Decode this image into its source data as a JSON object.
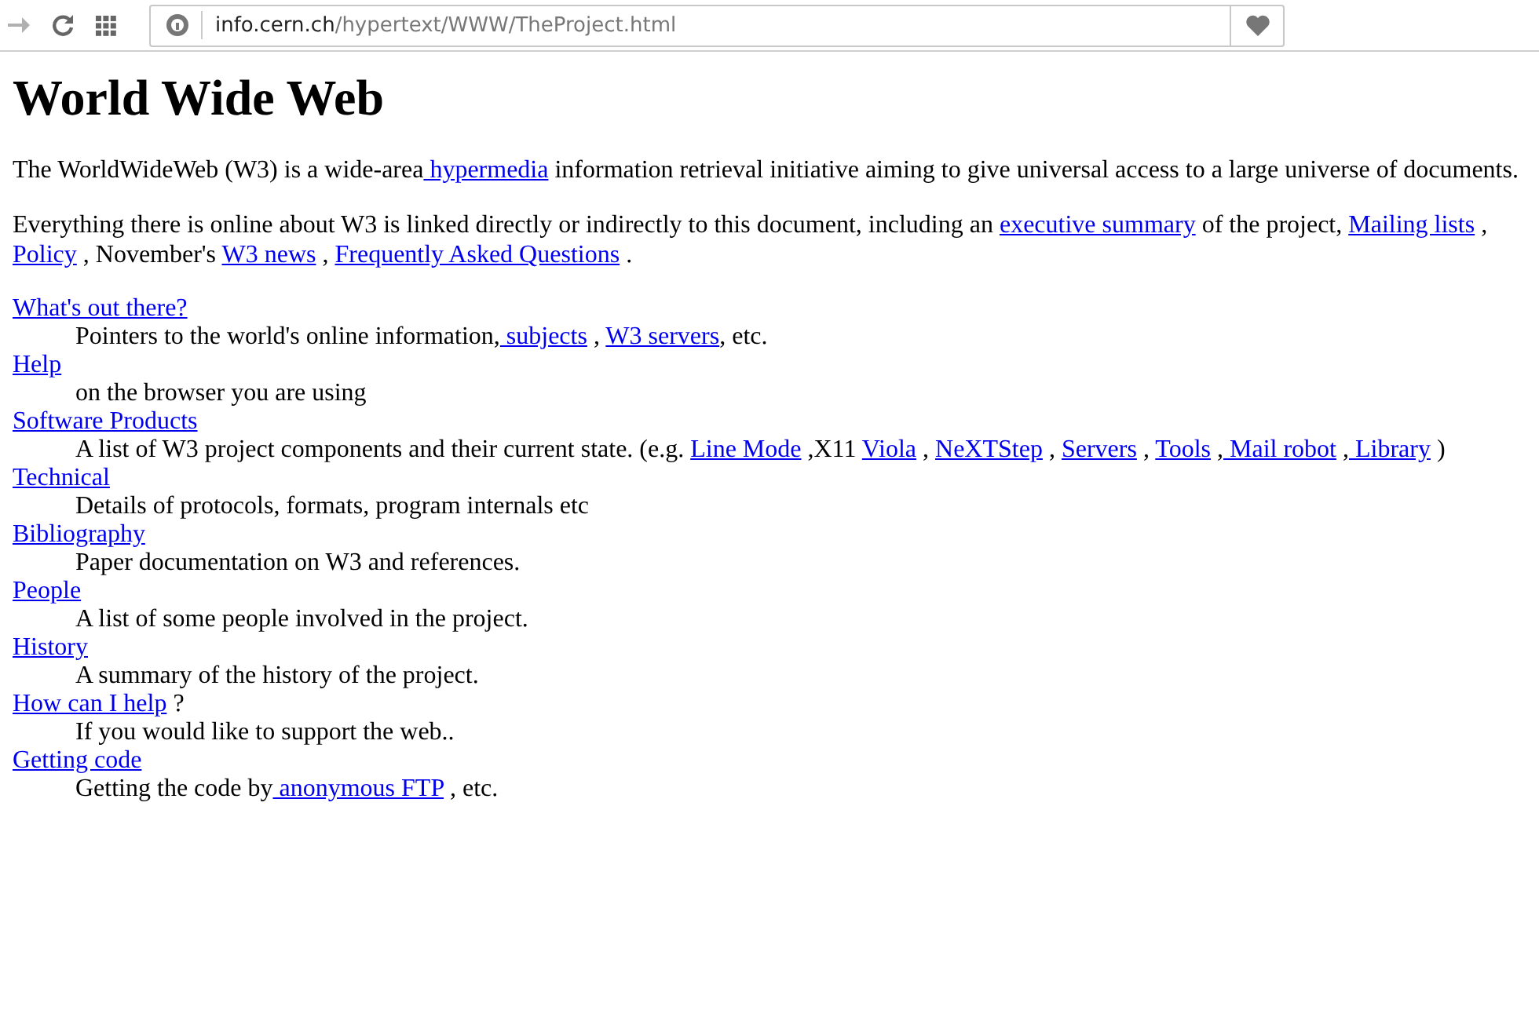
{
  "toolbar": {
    "url_host": "info.cern.ch",
    "url_path": "/hypertext/WWW/TheProject.html"
  },
  "heading": "World Wide Web",
  "paragraphs": [
    [
      {
        "kind": "text",
        "text": "The WorldWideWeb (W3) is a wide-area"
      },
      {
        "kind": "link",
        "text": " hypermedia"
      },
      {
        "kind": "text",
        "text": " information retrieval initiative aiming to give universal access to a large universe of documents."
      }
    ],
    [
      {
        "kind": "text",
        "text": "Everything there is online about W3 is linked directly or indirectly to this document, including an "
      },
      {
        "kind": "link",
        "text": "executive summary"
      },
      {
        "kind": "text",
        "text": " of the project, "
      },
      {
        "kind": "link",
        "text": "Mailing lists"
      },
      {
        "kind": "text",
        "text": " , "
      },
      {
        "kind": "link",
        "text": "Policy"
      },
      {
        "kind": "text",
        "text": " , November's "
      },
      {
        "kind": "link",
        "text": "W3 news"
      },
      {
        "kind": "text",
        "text": " , "
      },
      {
        "kind": "link",
        "text": "Frequently Asked Questions"
      },
      {
        "kind": "text",
        "text": " ."
      }
    ]
  ],
  "entries": [
    {
      "term": [
        {
          "kind": "link",
          "text": "What's out there?"
        }
      ],
      "definition": [
        {
          "kind": "text",
          "text": "Pointers to the world's online information,"
        },
        {
          "kind": "link",
          "text": " subjects"
        },
        {
          "kind": "text",
          "text": " , "
        },
        {
          "kind": "link",
          "text": "W3 servers"
        },
        {
          "kind": "text",
          "text": ", etc."
        }
      ]
    },
    {
      "term": [
        {
          "kind": "link",
          "text": "Help"
        }
      ],
      "definition": [
        {
          "kind": "text",
          "text": "on the browser you are using"
        }
      ]
    },
    {
      "term": [
        {
          "kind": "link",
          "text": "Software Products"
        }
      ],
      "definition": [
        {
          "kind": "text",
          "text": "A list of W3 project components and their current state. (e.g. "
        },
        {
          "kind": "link",
          "text": "Line Mode"
        },
        {
          "kind": "text",
          "text": " ,X11 "
        },
        {
          "kind": "link",
          "text": "Viola"
        },
        {
          "kind": "text",
          "text": " , "
        },
        {
          "kind": "link",
          "text": "NeXTStep"
        },
        {
          "kind": "text",
          "text": " , "
        },
        {
          "kind": "link",
          "text": "Servers"
        },
        {
          "kind": "text",
          "text": " , "
        },
        {
          "kind": "link",
          "text": "Tools"
        },
        {
          "kind": "text",
          "text": " ,"
        },
        {
          "kind": "link",
          "text": " Mail robot"
        },
        {
          "kind": "text",
          "text": " ,"
        },
        {
          "kind": "link",
          "text": " Library"
        },
        {
          "kind": "text",
          "text": " )"
        }
      ]
    },
    {
      "term": [
        {
          "kind": "link",
          "text": "Technical"
        }
      ],
      "definition": [
        {
          "kind": "text",
          "text": "Details of protocols, formats, program internals etc"
        }
      ]
    },
    {
      "term": [
        {
          "kind": "link",
          "text": "Bibliography"
        }
      ],
      "definition": [
        {
          "kind": "text",
          "text": "Paper documentation on W3 and references."
        }
      ]
    },
    {
      "term": [
        {
          "kind": "link",
          "text": "People"
        }
      ],
      "definition": [
        {
          "kind": "text",
          "text": "A list of some people involved in the project."
        }
      ]
    },
    {
      "term": [
        {
          "kind": "link",
          "text": "History"
        }
      ],
      "definition": [
        {
          "kind": "text",
          "text": "A summary of the history of the project."
        }
      ]
    },
    {
      "term": [
        {
          "kind": "link",
          "text": "How can I help"
        },
        {
          "kind": "text",
          "text": " ?"
        }
      ],
      "definition": [
        {
          "kind": "text",
          "text": "If you would like to support the web.."
        }
      ]
    },
    {
      "term": [
        {
          "kind": "link",
          "text": "Getting code"
        }
      ],
      "definition": [
        {
          "kind": "text",
          "text": "Getting the code by"
        },
        {
          "kind": "link",
          "text": " anonymous FTP"
        },
        {
          "kind": "text",
          "text": " , etc."
        }
      ]
    }
  ]
}
